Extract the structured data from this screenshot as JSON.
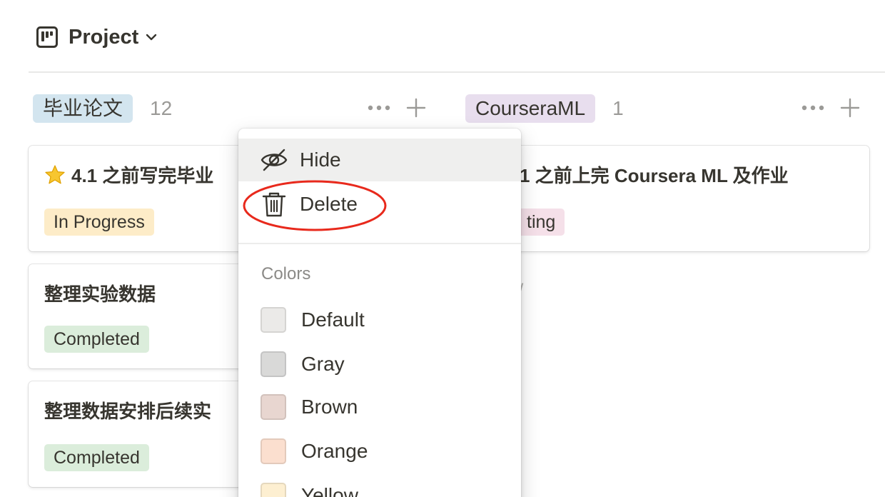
{
  "view": {
    "title": "Project",
    "icon": "board-icon"
  },
  "groups": [
    {
      "label": "毕业论文",
      "count": "12",
      "color": "#d3e5ef",
      "cards": [
        {
          "title": "4.1 之前写完毕业",
          "has_star": true,
          "status": "In Progress",
          "status_color": "#fdecc8"
        },
        {
          "title": "整理实验数据",
          "has_star": false,
          "status": "Completed",
          "status_color": "#dbeddb"
        },
        {
          "title": "整理数据安排后续实",
          "has_star": false,
          "status": "Completed",
          "status_color": "#dbeddb"
        }
      ]
    },
    {
      "label": "CourseraML",
      "count": "1",
      "color": "#e8deee",
      "cards": [
        {
          "title": "1 之前上完 Coursera ML 及作业",
          "status": "ting",
          "status_color": "#f5e0e9"
        }
      ],
      "new_label": "ew"
    }
  ],
  "menu": {
    "items": [
      {
        "label": "Hide",
        "icon": "eye-off-icon"
      },
      {
        "label": "Delete",
        "icon": "trash-icon"
      }
    ],
    "section_label": "Colors",
    "colors": [
      {
        "label": "Default",
        "swatch": "#ebeae8"
      },
      {
        "label": "Gray",
        "swatch": "#d9d9d8"
      },
      {
        "label": "Brown",
        "swatch": "#e8d6d0"
      },
      {
        "label": "Orange",
        "swatch": "#fbdfcf"
      },
      {
        "label": "Yellow",
        "swatch": "#fdefd1"
      }
    ]
  },
  "annotation_color": "#e8291c"
}
